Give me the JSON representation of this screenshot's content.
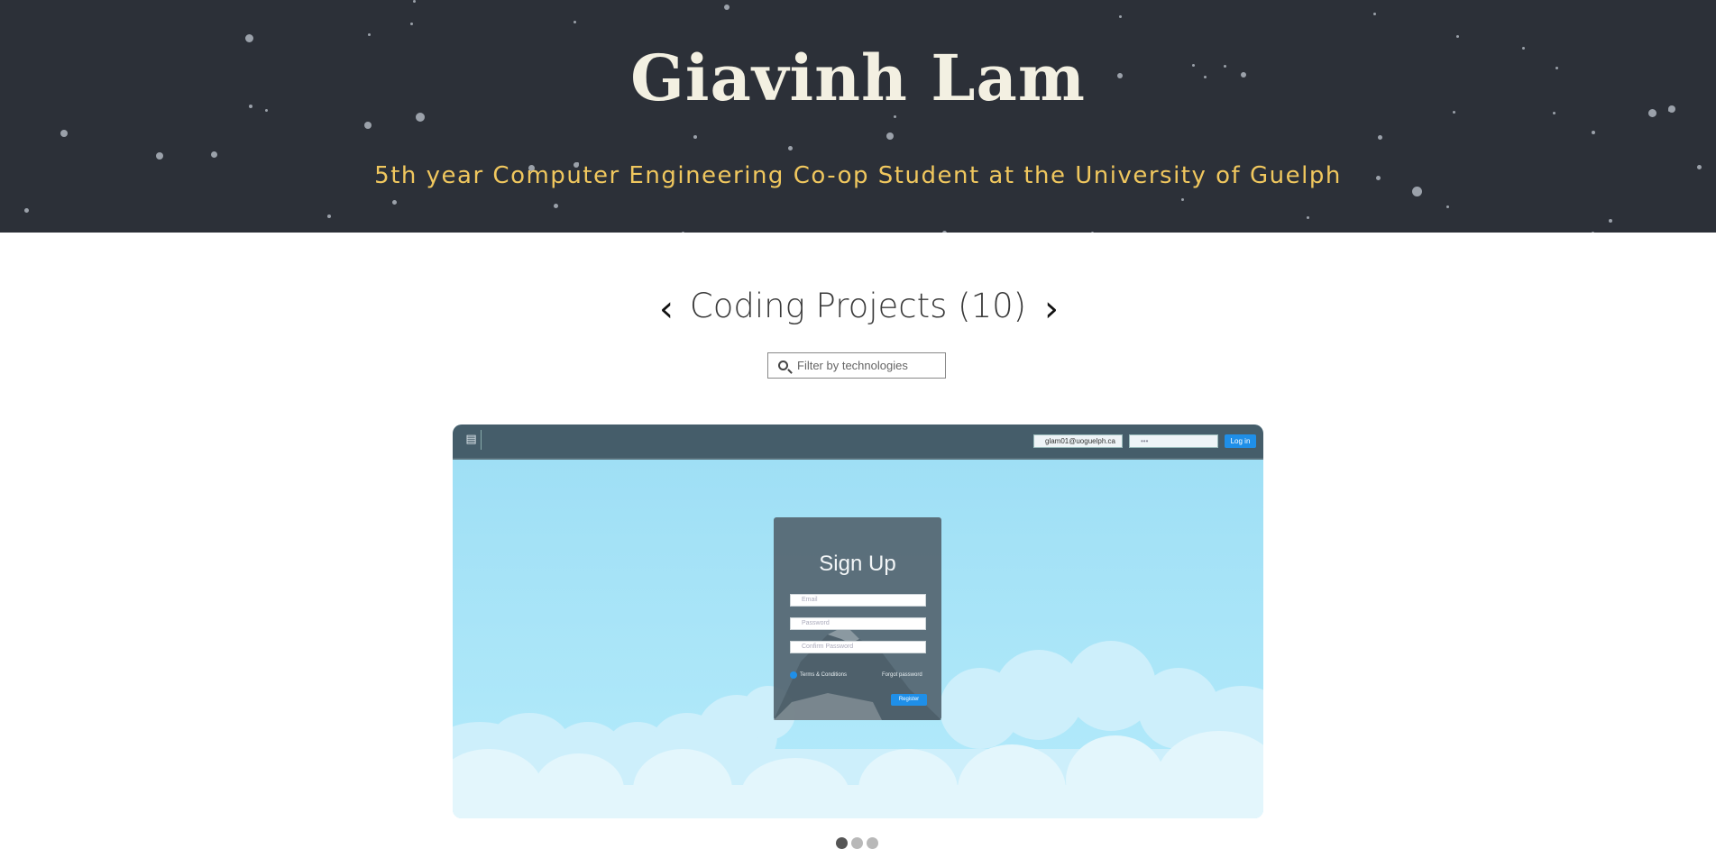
{
  "hero": {
    "title": "Giavinh Lam",
    "subtitle": "5th year Computer Engineering Co-op Student at the University of Guelph"
  },
  "projects": {
    "heading": "Coding Projects (10)",
    "prev_label": "‹",
    "next_label": "›",
    "filter_placeholder": "Filter by technologies"
  },
  "screenshot": {
    "nav_email": "glam01@uoguelph.ca",
    "nav_password": "•••",
    "login_label": "Log in",
    "card_title": "Sign Up",
    "email_placeholder": "Email",
    "password_placeholder": "Password",
    "confirm_placeholder": "Confirm Password",
    "terms_label": "Terms & Conditions",
    "forgot_label": "Forgot password",
    "register_label": "Register"
  },
  "carousel": {
    "slide_count": 3,
    "active_index": 0
  }
}
